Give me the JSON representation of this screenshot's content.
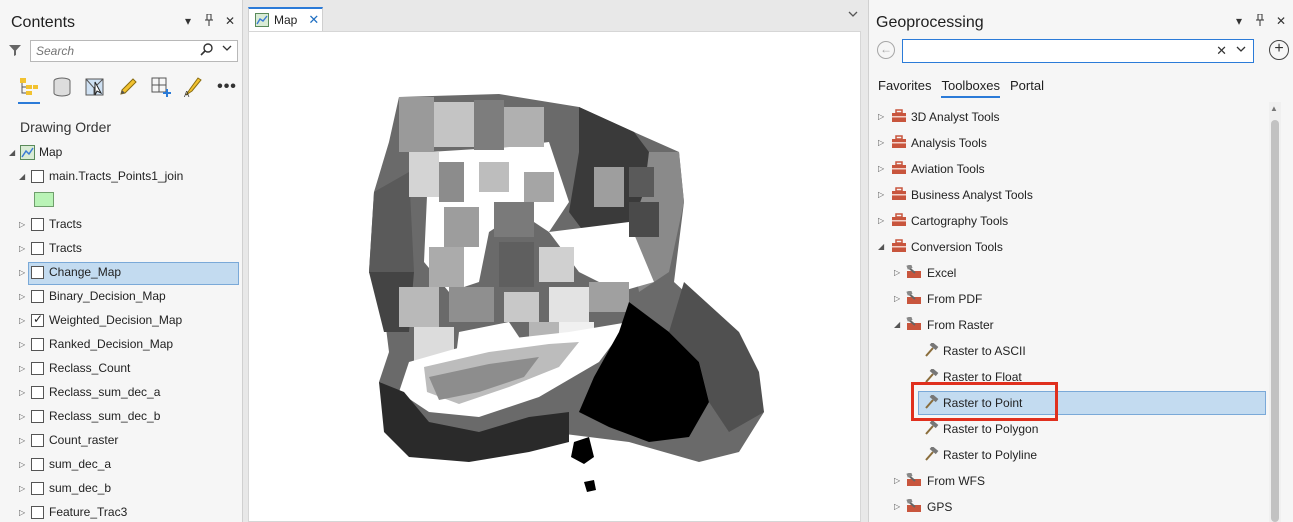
{
  "contents": {
    "title": "Contents",
    "search_placeholder": "Search",
    "drawing_order_label": "Drawing Order",
    "map_node": "Map",
    "layers": [
      {
        "label": "main.Tracts_Points1_join",
        "checked": false,
        "expander": "◢"
      },
      {
        "label": "Tracts",
        "checked": false,
        "expander": "▷"
      },
      {
        "label": "Tracts",
        "checked": false,
        "expander": "▷"
      },
      {
        "label": "Change_Map",
        "checked": false,
        "expander": "▷",
        "selected": true
      },
      {
        "label": "Binary_Decision_Map",
        "checked": false,
        "expander": "▷"
      },
      {
        "label": "Weighted_Decision_Map",
        "checked": true,
        "expander": "▷"
      },
      {
        "label": "Ranked_Decision_Map",
        "checked": false,
        "expander": "▷"
      },
      {
        "label": "Reclass_Count",
        "checked": false,
        "expander": "▷"
      },
      {
        "label": "Reclass_sum_dec_a",
        "checked": false,
        "expander": "▷"
      },
      {
        "label": "Reclass_sum_dec_b",
        "checked": false,
        "expander": "▷"
      },
      {
        "label": "Count_raster",
        "checked": false,
        "expander": "▷"
      },
      {
        "label": "sum_dec_a",
        "checked": false,
        "expander": "▷"
      },
      {
        "label": "sum_dec_b",
        "checked": false,
        "expander": "▷"
      },
      {
        "label": "Feature_Trac3",
        "checked": false,
        "expander": "▷"
      }
    ],
    "swatch_color": "#b9f3b6"
  },
  "map_view": {
    "tab_label": "Map"
  },
  "geoprocessing": {
    "title": "Geoprocessing",
    "search_value": "",
    "tabs": [
      "Favorites",
      "Toolboxes",
      "Portal"
    ],
    "active_tab": "Toolboxes",
    "tree": [
      {
        "label": "3D Analyst Tools",
        "level": 0,
        "kind": "toolbox",
        "expander": "▷"
      },
      {
        "label": "Analysis Tools",
        "level": 0,
        "kind": "toolbox",
        "expander": "▷"
      },
      {
        "label": "Aviation Tools",
        "level": 0,
        "kind": "toolbox",
        "expander": "▷"
      },
      {
        "label": "Business Analyst Tools",
        "level": 0,
        "kind": "toolbox",
        "expander": "▷"
      },
      {
        "label": "Cartography Tools",
        "level": 0,
        "kind": "toolbox",
        "expander": "▷"
      },
      {
        "label": "Conversion Tools",
        "level": 0,
        "kind": "toolbox",
        "expander": "◢"
      },
      {
        "label": "Excel",
        "level": 1,
        "kind": "toolset",
        "expander": "▷"
      },
      {
        "label": "From PDF",
        "level": 1,
        "kind": "toolset",
        "expander": "▷"
      },
      {
        "label": "From Raster",
        "level": 1,
        "kind": "toolset",
        "expander": "◢"
      },
      {
        "label": "Raster to ASCII",
        "level": 2,
        "kind": "tool"
      },
      {
        "label": "Raster to Float",
        "level": 2,
        "kind": "tool"
      },
      {
        "label": "Raster to Point",
        "level": 2,
        "kind": "tool",
        "selected": true
      },
      {
        "label": "Raster to Polygon",
        "level": 2,
        "kind": "tool"
      },
      {
        "label": "Raster to Polyline",
        "level": 2,
        "kind": "tool"
      },
      {
        "label": "From WFS",
        "level": 1,
        "kind": "toolset",
        "expander": "▷"
      },
      {
        "label": "GPS",
        "level": 1,
        "kind": "toolset",
        "expander": "▷"
      }
    ],
    "highlight_color": "#e0301e"
  }
}
